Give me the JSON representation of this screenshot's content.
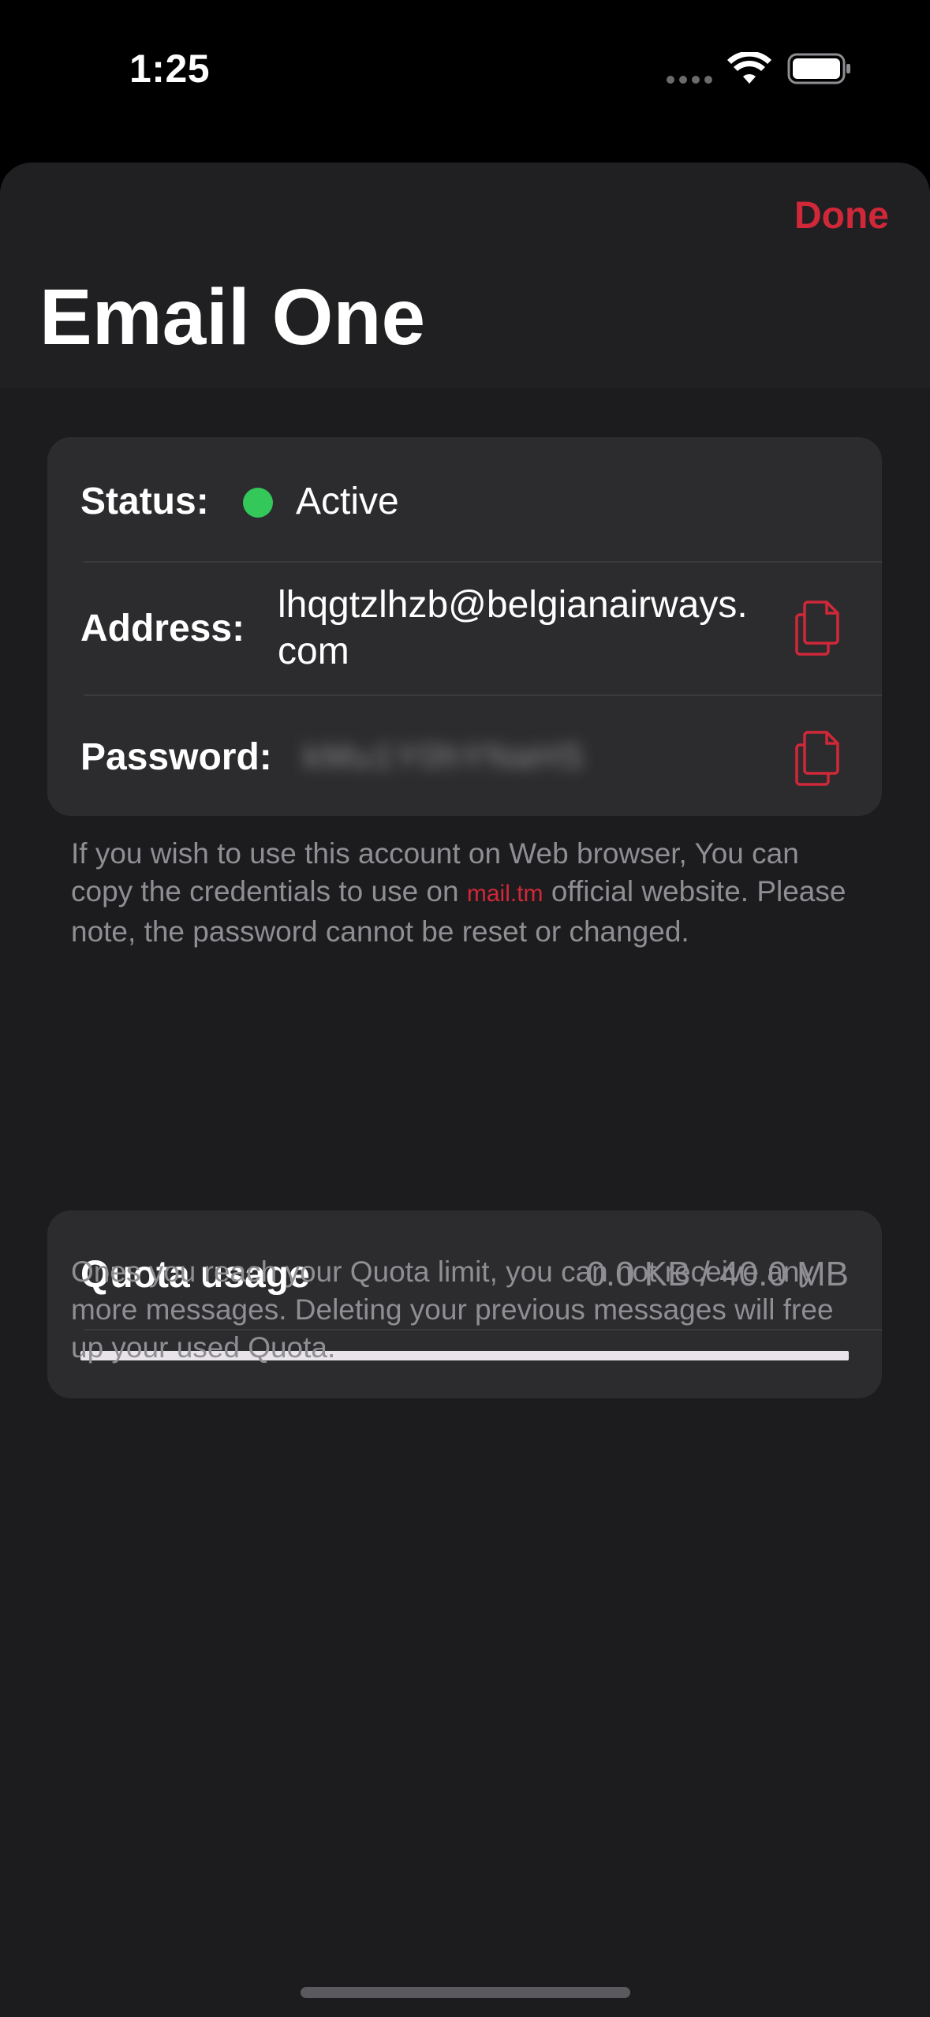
{
  "status_bar": {
    "time": "1:25"
  },
  "header": {
    "done_label": "Done",
    "title": "Email One"
  },
  "account": {
    "status_label": "Status:",
    "status_value": "Active",
    "status_color": "#34c759",
    "address_label": "Address:",
    "address_value": "lhqgtzlhzb@belgianairways.com",
    "password_label": "Password:",
    "password_value": "kMu1Y0hYNaHS"
  },
  "info_note": {
    "text_before": "If you wish to use this account on Web browser, You can copy the credentials to use on ",
    "link_text": "mail.tm",
    "text_after": " official website. Please note, the password cannot be reset or changed."
  },
  "quota": {
    "label": "Quota usage",
    "value": "0.0 KB / 40.0 MB",
    "used_fraction": 0.0
  },
  "quota_note": "Ones you reach your Quota limit, you can not receive any more messages. Deleting your previous messages will free up your used Quota.",
  "colors": {
    "accent": "#d02839",
    "background": "#1c1c1e",
    "card": "#2c2c2e",
    "secondary_text": "#8e8e93"
  },
  "icons": {
    "copy_address": "copy-icon",
    "copy_password": "copy-icon"
  }
}
